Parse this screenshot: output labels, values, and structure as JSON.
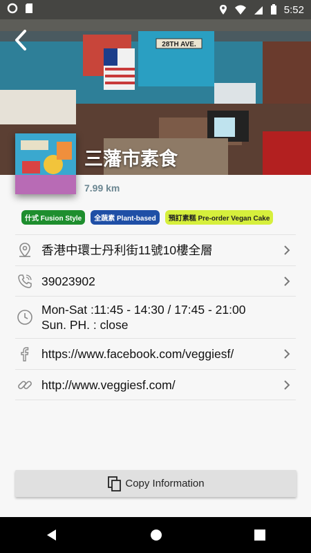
{
  "status_bar": {
    "time": "5:52"
  },
  "restaurant": {
    "name": "三藩市素食",
    "distance": "7.99 km"
  },
  "tags": [
    {
      "label": "什式 Fusion Style",
      "color": "#1e8e2e",
      "text_color": "#ffffff"
    },
    {
      "label": "全蔬素 Plant-based",
      "color": "#1f4fa6",
      "text_color": "#ffffff"
    },
    {
      "label": "預訂素糕 Pre-order Vegan Cake",
      "color": "#d6ef3c",
      "text_color": "#222222"
    }
  ],
  "info": {
    "address": "香港中環士丹利街11號10樓全層",
    "phone": "39023902",
    "hours_line1": "Mon-Sat  :11:45 - 14:30 / 17:45 - 21:00",
    "hours_line2": "Sun. PH. : close",
    "facebook": "https://www.facebook.com/veggiesf/",
    "website": "http://www.veggiesf.com/"
  },
  "actions": {
    "copy_label": "Copy Information"
  },
  "hero": {
    "sign_text": "28TH AVE."
  },
  "icons": {
    "back": "back-arrow-icon",
    "address": "location-pin-icon",
    "phone": "phone-icon",
    "hours": "clock-icon",
    "facebook": "facebook-icon",
    "website": "link-icon",
    "chevron": "chevron-right-icon",
    "copy": "copy-icon"
  }
}
